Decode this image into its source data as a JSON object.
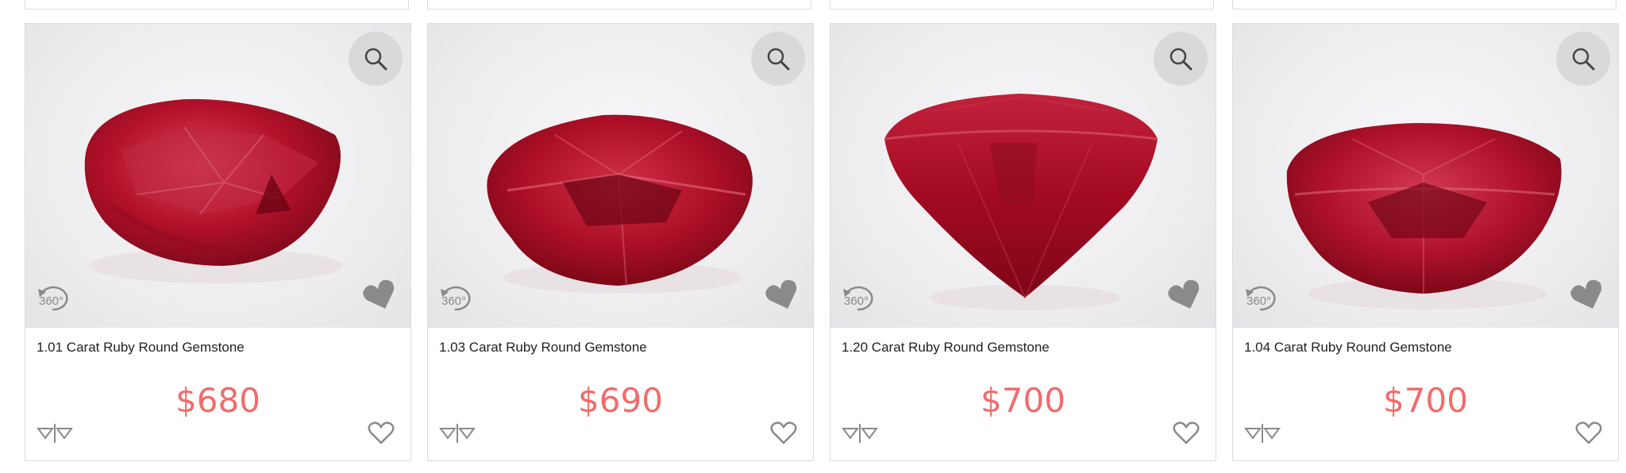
{
  "colors": {
    "price": "#f26b6b",
    "icon_gray": "#8a8a8a",
    "border": "#dcdcdc",
    "ruby": "#b3112a"
  },
  "badge_360_label": "360°",
  "products": [
    {
      "title": "1.01 Carat Ruby Round Gemstone",
      "price": "$680"
    },
    {
      "title": "1.03 Carat Ruby Round Gemstone",
      "price": "$690"
    },
    {
      "title": "1.20 Carat Ruby Round Gemstone",
      "price": "$700"
    },
    {
      "title": "1.04 Carat Ruby Round Gemstone",
      "price": "$700"
    }
  ],
  "icons": {
    "zoom": "search-icon",
    "rotate": "rotate-360-icon",
    "favorite_badge": "heart-filled-icon",
    "compare": "compare-icon",
    "wishlist": "heart-outline-icon"
  }
}
